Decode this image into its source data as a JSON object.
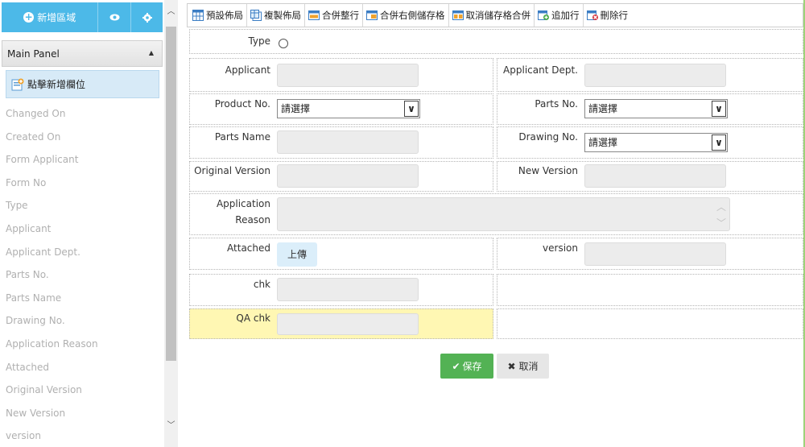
{
  "left_panel": {
    "add_area_label": "新增區域",
    "panel_title": "Main Panel",
    "add_field_label": "點擊新增欄位",
    "fields": [
      "Changed On",
      "Created On",
      "Form Applicant",
      "Form No",
      "Type",
      "Applicant",
      "Applicant Dept.",
      "Parts No.",
      "Parts Name",
      "Drawing No.",
      "Application Reason",
      "Attached",
      "Original Version",
      "New Version",
      "version"
    ]
  },
  "toolbar": {
    "default_layout": "預設佈局",
    "copy_layout": "複製佈局",
    "merge_row": "合併整行",
    "merge_right": "合併右側儲存格",
    "unmerge": "取消儲存格合併",
    "append_row": "追加行",
    "delete_row": "刪除行"
  },
  "form": {
    "type_label": "Type",
    "applicant_label": "Applicant",
    "applicant_dept_label": "Applicant Dept.",
    "product_no_label": "Product No.",
    "product_no_value": "請選擇",
    "parts_no_label": "Parts No.",
    "parts_no_value": "請選擇",
    "parts_name_label": "Parts Name",
    "drawing_no_label": "Drawing No.",
    "drawing_no_value": "請選擇",
    "original_version_label": "Original Version",
    "new_version_label": "New Version",
    "reason_label_1": "Application",
    "reason_label_2": "Reason",
    "attached_label": "Attached",
    "upload_label": "上傳",
    "version_label": "version",
    "chk_label": "chk",
    "qa_chk_label": "QA chk"
  },
  "actions": {
    "save": "保存",
    "cancel": "取消"
  },
  "colors": {
    "accent": "#4cb9e8",
    "save": "#53b254",
    "highlight_row": "#fff7b3"
  }
}
